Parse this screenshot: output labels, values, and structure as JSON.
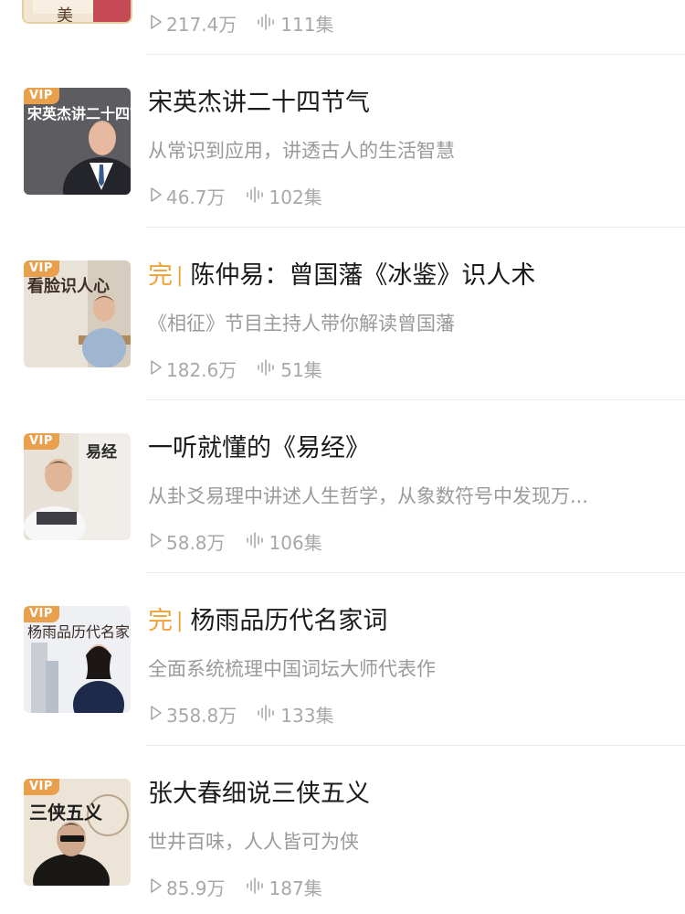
{
  "top_row": {
    "plays": "217.4万",
    "episodes": "111集",
    "cover_text": "美"
  },
  "items": [
    {
      "title": "宋英杰讲二十四节气",
      "completed": false,
      "description": "从常识到应用，讲透古人的生活智慧",
      "plays": "46.7万",
      "episodes": "102集",
      "vip": "VIP",
      "cover_text": "宋英杰讲二十四节气"
    },
    {
      "title": "陈仲易：曾国藩《冰鉴》识人术",
      "completed": true,
      "description": "《相征》节目主持人带你解读曾国藩",
      "plays": "182.6万",
      "episodes": "51集",
      "vip": "VIP",
      "cover_text": "看脸识人心"
    },
    {
      "title": "一听就懂的《易经》",
      "completed": false,
      "description": "从卦爻易理中讲述人生哲学，从象数符号中发现万...",
      "plays": "58.8万",
      "episodes": "106集",
      "vip": "VIP",
      "cover_text": "易经"
    },
    {
      "title": "杨雨品历代名家词",
      "completed": true,
      "description": "全面系统梳理中国词坛大师代表作",
      "plays": "358.8万",
      "episodes": "133集",
      "vip": "VIP",
      "cover_text": "杨雨品历代名家词"
    },
    {
      "title": "张大春细说三侠五义",
      "completed": false,
      "description": "世井百味，人人皆可为侠",
      "plays": "85.9万",
      "episodes": "187集",
      "vip": "VIP",
      "cover_text": "三侠五义"
    }
  ],
  "labels": {
    "completed": "完",
    "separator": "|"
  },
  "colors": {
    "vip_badge": "#e8a04c",
    "completed": "#f0a23a",
    "title": "#1a1a1a",
    "secondary": "#9a9a9a"
  }
}
